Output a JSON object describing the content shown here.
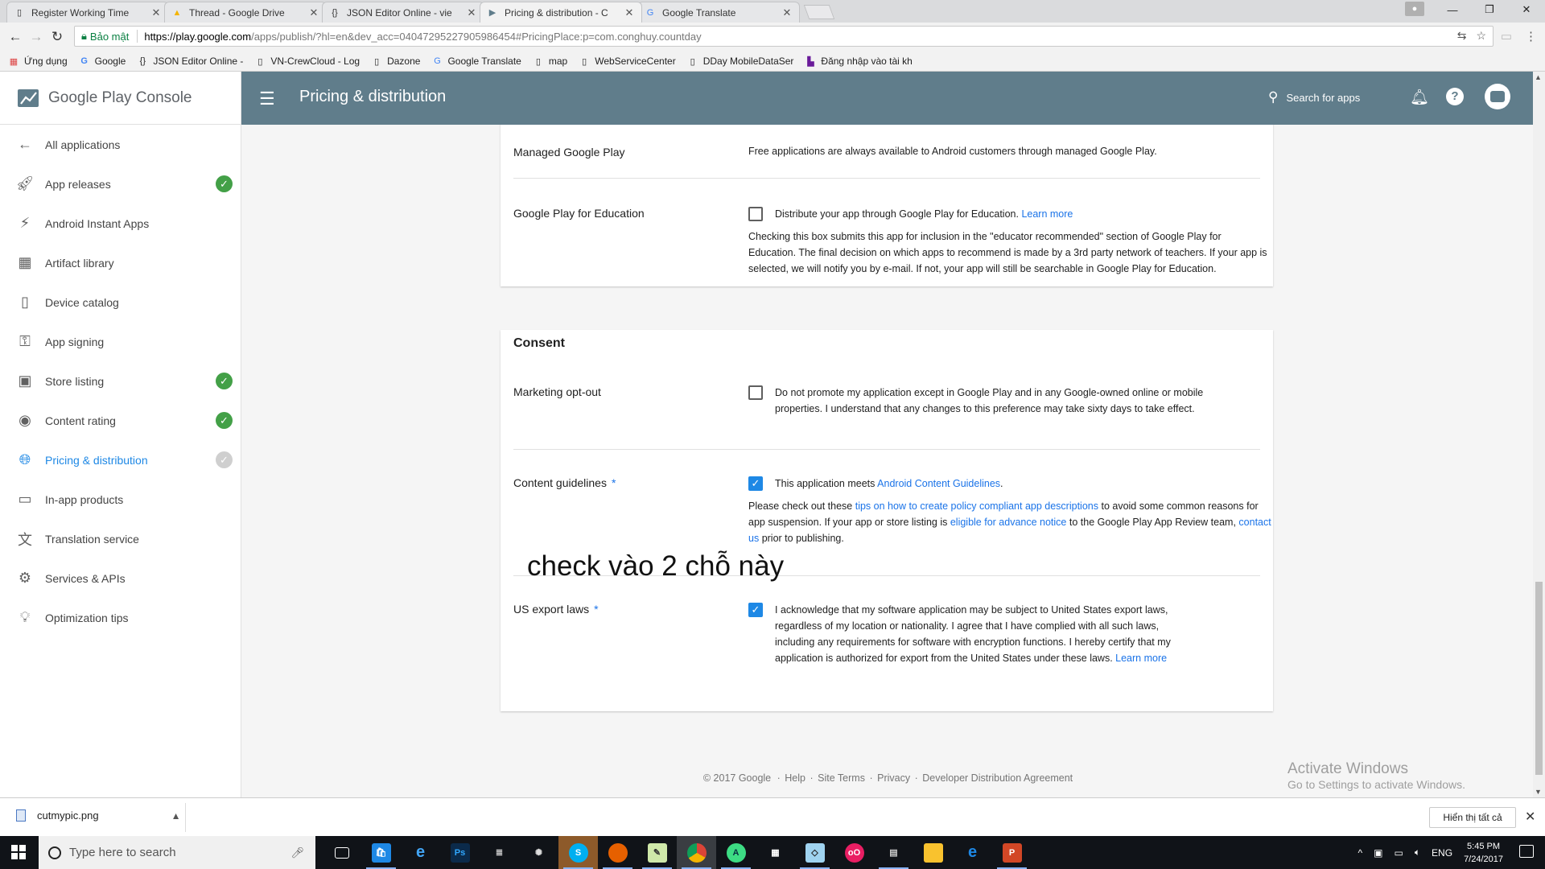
{
  "browser": {
    "tabs": [
      {
        "title": "Register Working Time",
        "icon": "doc-icon",
        "active": false
      },
      {
        "title": "Thread - Google Drive",
        "icon": "drive-icon",
        "active": false
      },
      {
        "title": "JSON Editor Online - vie",
        "icon": "json-icon",
        "active": false
      },
      {
        "title": "Pricing & distribution - C",
        "icon": "play-console-icon",
        "active": true
      },
      {
        "title": "Google Translate",
        "icon": "translate-icon",
        "active": false
      }
    ],
    "secure_label": "Bảo mật",
    "url_host": "https://play.google.com",
    "url_rest": "/apps/publish/?hl=en&dev_acc=04047295227905986454#PricingPlace:p=com.conghuy.countday",
    "bookmarks": [
      {
        "label": "Ứng dụng",
        "icon": "apps-grid-icon"
      },
      {
        "label": "Google",
        "icon": "google-g-icon"
      },
      {
        "label": "JSON Editor Online -",
        "icon": "json-icon"
      },
      {
        "label": "VN-CrewCloud - Log",
        "icon": "page-icon"
      },
      {
        "label": "Dazone",
        "icon": "page-icon"
      },
      {
        "label": "Google Translate",
        "icon": "translate-icon"
      },
      {
        "label": "map",
        "icon": "page-icon"
      },
      {
        "label": "WebServiceCenter",
        "icon": "page-icon"
      },
      {
        "label": "DDay MobileDataSer",
        "icon": "page-icon"
      },
      {
        "label": "Đăng nhập vào tài kh",
        "icon": "hp-icon"
      }
    ]
  },
  "console": {
    "brand": "Google Play Console",
    "page_title": "Pricing & distribution",
    "search_label": "Search for apps",
    "nav": [
      {
        "label": "All applications",
        "icon": "arrow-back-icon",
        "status": "none",
        "active": false
      },
      {
        "label": "App releases",
        "icon": "rocket-icon",
        "status": "done",
        "active": false
      },
      {
        "label": "Android Instant Apps",
        "icon": "bolt-icon",
        "status": "none",
        "active": false
      },
      {
        "label": "Artifact library",
        "icon": "library-icon",
        "status": "none",
        "active": false
      },
      {
        "label": "Device catalog",
        "icon": "device-icon",
        "status": "none",
        "active": false
      },
      {
        "label": "App signing",
        "icon": "key-icon",
        "status": "none",
        "active": false
      },
      {
        "label": "Store listing",
        "icon": "store-icon",
        "status": "done",
        "active": false
      },
      {
        "label": "Content rating",
        "icon": "rating-icon",
        "status": "done",
        "active": false
      },
      {
        "label": "Pricing & distribution",
        "icon": "globe-icon",
        "status": "pending",
        "active": true
      },
      {
        "label": "In-app products",
        "icon": "card-icon",
        "status": "none",
        "active": false
      },
      {
        "label": "Translation service",
        "icon": "translate-icon",
        "status": "none",
        "active": false
      },
      {
        "label": "Services & APIs",
        "icon": "services-icon",
        "status": "none",
        "active": false
      },
      {
        "label": "Optimization tips",
        "icon": "lightbulb-icon",
        "status": "none",
        "active": false
      }
    ]
  },
  "form": {
    "managed": {
      "label": "Managed Google Play",
      "text": "Free applications are always available to Android customers through managed Google Play."
    },
    "education": {
      "label": "Google Play for Education",
      "checkbox_text": "Distribute your app through Google Play for Education.",
      "learn_more": "Learn more",
      "checked": false,
      "note": "Checking this box submits this app for inclusion in the \"educator recommended\" section of Google Play for Education. The final decision on which apps to recommend is made by a 3rd party network of teachers. If your app is selected, we will notify you by e-mail. If not, your app will still be searchable in Google Play for Education."
    },
    "consent_title": "Consent",
    "marketing": {
      "label": "Marketing opt-out",
      "checked": false,
      "text": "Do not promote my application except in Google Play and in any Google-owned online or mobile properties. I understand that any changes to this preference may take sixty days to take effect."
    },
    "guidelines": {
      "label": "Content guidelines",
      "required": "*",
      "checked": true,
      "text_prefix": "This application meets",
      "link": "Android Content Guidelines",
      "text_suffix": ".",
      "note_a": "Please check out these",
      "note_link1": "tips on how to create policy compliant app descriptions",
      "note_b": "to avoid some common reasons for app suspension. If your app or store listing is",
      "note_link2": "eligible for advance notice",
      "note_c": "to the Google Play App Review team,",
      "note_link3": "contact us",
      "note_d": "prior to publishing."
    },
    "export": {
      "label": "US export laws",
      "required": "*",
      "checked": true,
      "text": "I acknowledge that my software application may be subject to United States export laws, regardless of my location or nationality. I agree that I have complied with all such laws, including any requirements for software with encryption functions. I hereby certify that my application is authorized for export from the United States under these laws.",
      "learn_more": "Learn more"
    }
  },
  "annotation": "check vào 2 chỗ này",
  "footer": [
    "© 2017 Google",
    "Help",
    "Site Terms",
    "Privacy",
    "Developer Distribution Agreement"
  ],
  "footer_sep": "·",
  "watermark": {
    "line1": "Activate Windows",
    "line2": "Go to Settings to activate Windows."
  },
  "downloads": {
    "file": "cutmypic.png",
    "show_all": "Hiển thị tất cả"
  },
  "taskbar": {
    "search_placeholder": "Type here to search",
    "lang": "ENG",
    "time": "5:45 PM",
    "date": "7/24/2017"
  },
  "colors": {
    "accent": "#1e88e5",
    "topbar": "#607d8b",
    "done": "#43a047"
  }
}
